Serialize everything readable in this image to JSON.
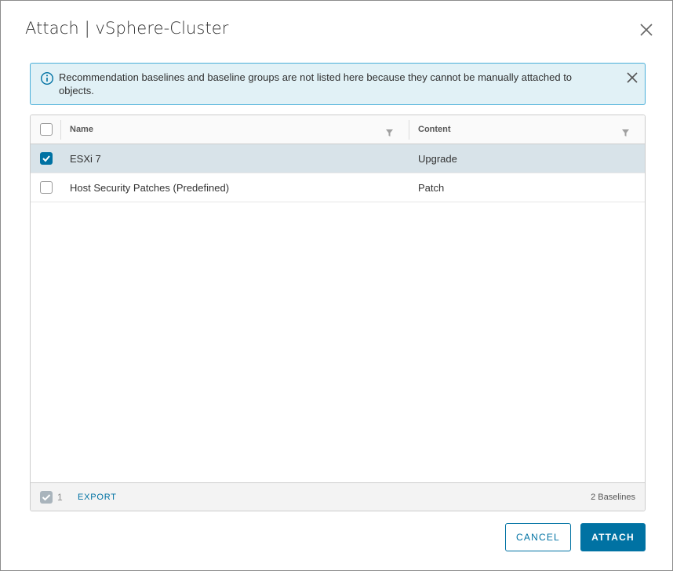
{
  "dialog": {
    "title": "Attach | vSphere-Cluster"
  },
  "alert": {
    "message": "Recommendation baselines and baseline groups are not listed here because they cannot be manually attached to objects."
  },
  "grid": {
    "columns": [
      {
        "label": "Name"
      },
      {
        "label": "Content"
      }
    ],
    "rows": [
      {
        "name": "ESXi 7",
        "content": "Upgrade",
        "checked": true
      },
      {
        "name": "Host Security Patches (Predefined)",
        "content": "Patch",
        "checked": false
      }
    ],
    "footer": {
      "selected_count": "1",
      "export_label": "EXPORT",
      "total_label": "2 Baselines"
    }
  },
  "buttons": {
    "cancel": "CANCEL",
    "attach": "ATTACH"
  },
  "colors": {
    "accent": "#0072a3",
    "alert_bg": "#e1f1f6",
    "alert_border": "#49afd9",
    "selected_row": "#d8e3e9"
  }
}
